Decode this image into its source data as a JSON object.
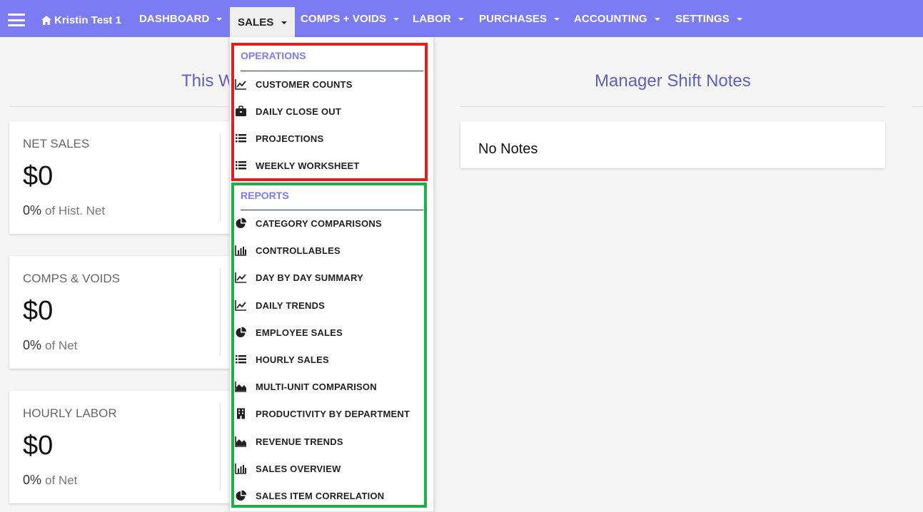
{
  "nav": {
    "brand": "Kristin Test 1",
    "items": [
      {
        "label": "DASHBOARD"
      },
      {
        "label": "SALES"
      },
      {
        "label": "COMPS + VOIDS"
      },
      {
        "label": "LABOR"
      },
      {
        "label": "PURCHASES"
      },
      {
        "label": "ACCOUNTING"
      },
      {
        "label": "SETTINGS"
      }
    ]
  },
  "left": {
    "title": "This W",
    "cards": [
      {
        "label": "NET SALES",
        "value": "$0",
        "pct": "0%",
        "sub": "of Hist. Net"
      },
      {
        "label": "COMPS & VOIDS",
        "value": "$0",
        "pct": "0%",
        "sub": "of Net"
      },
      {
        "label": "HOURLY LABOR",
        "value": "$0",
        "pct": "0%",
        "sub": "of Net"
      }
    ]
  },
  "notes": {
    "title": "Manager Shift Notes",
    "empty": "No Notes"
  },
  "dropdown": {
    "operations": {
      "header": "OPERATIONS",
      "items": [
        {
          "label": "CUSTOMER COUNTS",
          "icon": "line-chart-icon"
        },
        {
          "label": "DAILY CLOSE OUT",
          "icon": "briefcase-icon"
        },
        {
          "label": "PROJECTIONS",
          "icon": "list-icon"
        },
        {
          "label": "WEEKLY WORKSHEET",
          "icon": "list-icon"
        }
      ]
    },
    "reports": {
      "header": "REPORTS",
      "items": [
        {
          "label": "CATEGORY COMPARISONS",
          "icon": "pie-chart-icon"
        },
        {
          "label": "CONTROLLABLES",
          "icon": "bar-chart-icon"
        },
        {
          "label": "DAY BY DAY SUMMARY",
          "icon": "line-chart-icon"
        },
        {
          "label": "DAILY TRENDS",
          "icon": "line-chart-icon"
        },
        {
          "label": "EMPLOYEE SALES",
          "icon": "pie-chart-icon"
        },
        {
          "label": "HOURLY SALES",
          "icon": "list-icon"
        },
        {
          "label": "MULTI-UNIT COMPARISON",
          "icon": "area-chart-icon"
        },
        {
          "label": "PRODUCTIVITY BY DEPARTMENT",
          "icon": "building-icon"
        },
        {
          "label": "REVENUE TRENDS",
          "icon": "area-chart-icon"
        },
        {
          "label": "SALES OVERVIEW",
          "icon": "bar-chart-icon"
        },
        {
          "label": "SALES ITEM CORRELATION",
          "icon": "pie-chart-icon"
        }
      ]
    }
  },
  "colors": {
    "nav_bg": "#7b7bf4",
    "title_color": "#5f5fbf",
    "highlight_operations": "#e02020",
    "highlight_reports": "#1fae4a"
  }
}
